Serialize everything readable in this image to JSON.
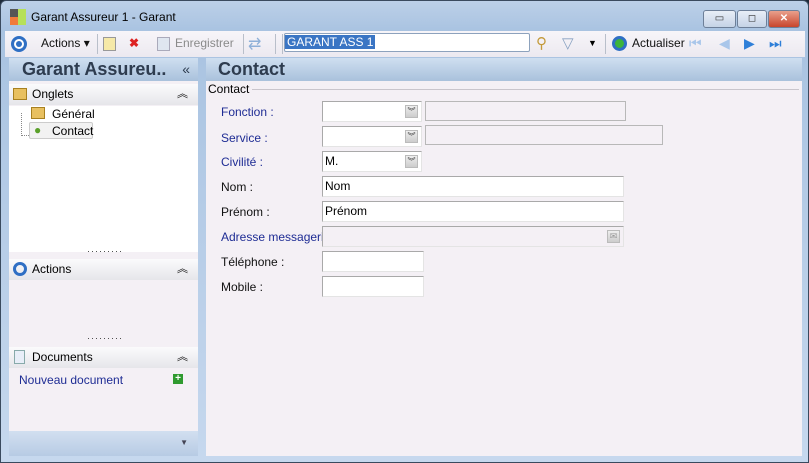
{
  "window": {
    "title": "Garant Assureur 1 -  Garant",
    "min": "▭",
    "max": "◻",
    "close": "✕"
  },
  "toolbar": {
    "actions": "Actions",
    "save": "Enregistrer",
    "search_value": "GARANT ASS 1",
    "refresh": "Actualiser"
  },
  "left": {
    "title": "Garant Assureu..",
    "collapse": "«",
    "onglets": {
      "label": "Onglets",
      "items": [
        "Général",
        "Contact"
      ]
    },
    "actions": {
      "label": "Actions"
    },
    "documents": {
      "label": "Documents",
      "new_doc": "Nouveau document"
    }
  },
  "main": {
    "title": "Contact",
    "group": "Contact",
    "fields": [
      {
        "label": "Fonction :",
        "value": ""
      },
      {
        "label": "Service :",
        "value": ""
      },
      {
        "label": "Civilité :",
        "value": "M."
      },
      {
        "label": "Nom :",
        "value": "Nom"
      },
      {
        "label": "Prénom :",
        "value": "Prénom"
      },
      {
        "label": "Adresse messagerie :",
        "value": ""
      },
      {
        "label": "Téléphone :",
        "value": ""
      },
      {
        "label": "Mobile :",
        "value": ""
      }
    ]
  }
}
